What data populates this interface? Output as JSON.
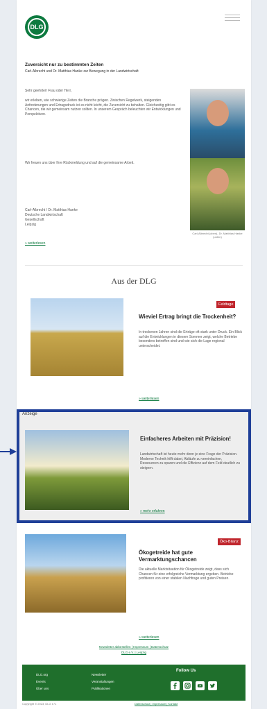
{
  "header": {
    "logo_text": "DLG"
  },
  "lead": {
    "title": "Zuversicht nur zu bestimmten Zeiten",
    "subtitle": "Carl-Albrecht und Dr. Matthias Hanke zur Bewegung in der Landwirtschaft",
    "greeting": "Sehr geehrte/r Frau oder Herr,",
    "paragraph": "wir erleben, wie schwierige Zeiten die Branche prägen. Zwischen Regelwerk, steigenden Anforderungen und Ertragsdruck ist es nicht leicht, die Zuversicht zu behalten. Gleichzeitig gibt es Chancen, die wir gemeinsam nutzen sollten. In unserem Gespräch beleuchten wir Entwicklungen und Perspektiven.",
    "paragraph2": "Wir freuen uns über Ihre Rückmeldung und auf die gemeinsame Arbeit.",
    "signature_1": "Carl-Albrecht / Dr. Matthias Hanke",
    "signature_2": "Deutsche Landwirtschaft",
    "signature_3": "Gesellschaft",
    "signature_4": "Leipzig",
    "more": "» weiterlesen",
    "photo_caption": "Carl-Albrecht (oben), Dr. Matthias Hanke (unten)"
  },
  "section": {
    "title": "Aus der DLG"
  },
  "articles": [
    {
      "badge": "Feldtage",
      "title": "Wieviel Ertrag bringt die Trockenheit?",
      "text": "In trockenen Jahren sind die Erträge oft stark unter Druck. Ein Blick auf die Entwicklungen in diesem Sommer zeigt, welche Betriebe besonders betroffen sind und wie sich die Lage regional unterscheidet.",
      "more": "» weiterlesen"
    },
    {
      "label": "Anzeige",
      "title": "Einfacheres Arbeiten mit Präzision!",
      "text": "Landwirtschaft ist heute mehr denn je eine Frage der Präzision. Moderne Technik hilft dabei, Abläufe zu vereinfachen, Ressourcen zu sparen und die Effizienz auf dem Feld deutlich zu steigern.",
      "more": "» mehr erfahren"
    },
    {
      "badge": "Öko-Bilanz",
      "title": "Ökogetreide hat gute Vermarktungschancen",
      "text": "Die aktuelle Marktsituation für Ökogetreide zeigt, dass sich Chancen für eine erfolgreiche Vermarktung ergeben. Betriebe profitieren von einer stabilen Nachfrage und guten Preisen.",
      "more": "» weiterlesen"
    }
  ],
  "links": {
    "line1": "Newsletter abbestellen | Impressum | Datenschutz",
    "line2": "DLG e.V. | Leipzig"
  },
  "footer": {
    "col1": [
      "DLG.org",
      "Events",
      "Über uns"
    ],
    "col2": [
      "Newsletter",
      "Veranstaltungen",
      "Publikationen"
    ],
    "follow": "Follow Us",
    "social": [
      "facebook-icon",
      "instagram-icon",
      "youtube-icon",
      "twitter-icon"
    ],
    "copyright": "Copyright © 2023, DLG e.V.",
    "privacy": "Datenschutz | Impressum | Kontakt"
  },
  "colors": {
    "brand_green": "#1f6f2c",
    "badge_red": "#c0262d",
    "ad_border": "#1f3f98"
  }
}
